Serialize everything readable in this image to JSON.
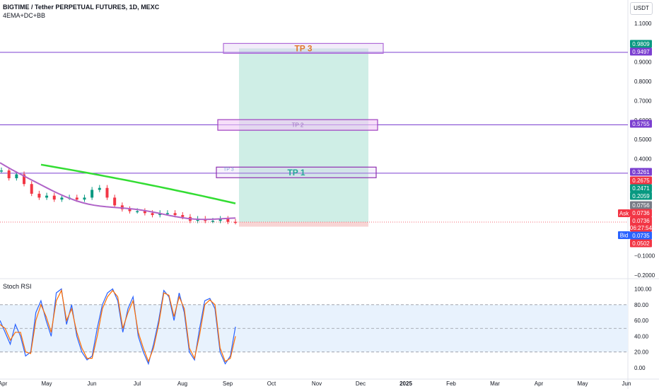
{
  "header": {
    "title": "BIGTIME / Tether PERPETUAL FUTURES, 1D, MEXC",
    "indicator": "4EMA+DC+BB",
    "currency": "USDT"
  },
  "rsi_title": "Stoch RSI",
  "colors": {
    "purple_line": "#7b3fd0",
    "ema_green": "#33dd33",
    "bb_purple": "#b064c8",
    "target_zone": "#cfeee6",
    "stop_zone": "#f8d4d4",
    "tp3_text": "#e07a2e",
    "tp1_text": "#26a69a",
    "rsi_k": "#2962ff",
    "rsi_d": "#ff6d00",
    "rsi_band": "#e8f2fd"
  },
  "chart_data": [
    {
      "type": "candlestick",
      "title": "BIGTIME / Tether PERPETUAL FUTURES, 1D, MEXC",
      "ylim": [
        -0.22,
        1.15
      ],
      "y_ticks": [
        1.1,
        0.9,
        0.8,
        0.7,
        0.6,
        0.5,
        0.4,
        0.1,
        -0.1,
        -0.2
      ],
      "y_tick_labels": [
        "1.1000",
        "0.9000",
        "0.8000",
        "0.7000",
        "0.6000",
        "0.5000",
        "0.4000",
        "0.1000",
        "−0.1000",
        "−0.2000"
      ],
      "x_month_labels": [
        "Apr",
        "May",
        "Jun",
        "Jul",
        "Aug",
        "Sep",
        "Oct",
        "Nov",
        "Dec",
        "2025",
        "Feb",
        "Mar",
        "Apr",
        "May",
        "Jun"
      ],
      "price_points": [
        [
          "Apr",
          0.34
        ],
        [
          "Apr",
          0.3
        ],
        [
          "Apr",
          0.32
        ],
        [
          "Apr",
          0.27
        ],
        [
          "Apr",
          0.22
        ],
        [
          "Apr",
          0.2
        ],
        [
          "May",
          0.21
        ],
        [
          "May",
          0.19
        ],
        [
          "May",
          0.2
        ],
        [
          "May",
          0.2
        ],
        [
          "May",
          0.19
        ],
        [
          "May",
          0.2
        ],
        [
          "Jun",
          0.24
        ],
        [
          "Jun",
          0.25
        ],
        [
          "Jun",
          0.2
        ],
        [
          "Jun",
          0.16
        ],
        [
          "Jun",
          0.14
        ],
        [
          "Jun",
          0.13
        ],
        [
          "Jul",
          0.13
        ],
        [
          "Jul",
          0.12
        ],
        [
          "Jul",
          0.11
        ],
        [
          "Jul",
          0.12
        ],
        [
          "Jul",
          0.12
        ],
        [
          "Jul",
          0.11
        ],
        [
          "Aug",
          0.1
        ],
        [
          "Aug",
          0.08
        ],
        [
          "Aug",
          0.09
        ],
        [
          "Aug",
          0.08
        ],
        [
          "Aug",
          0.08
        ],
        [
          "Aug",
          0.09
        ],
        [
          "Sep",
          0.075
        ],
        [
          "Sep",
          0.074
        ]
      ],
      "horizontal_lines": [
        0.9497,
        0.5755,
        0.3261
      ],
      "targets": [
        {
          "label": "TP 3",
          "price": 0.97
        },
        {
          "label": "TP 2",
          "price": 0.575
        },
        {
          "label": "TP 1",
          "price": 0.33
        },
        {
          "label": "TP 3",
          "price": 0.31
        }
      ],
      "price_tags": [
        {
          "text": "0.9809",
          "value": 0.9809,
          "color": "#089981"
        },
        {
          "text": "0.9497",
          "value": 0.9497,
          "color": "#7b3fd0"
        },
        {
          "text": "0.5755",
          "value": 0.5755,
          "color": "#7b3fd0"
        },
        {
          "text": "0.3261",
          "value": 0.3261,
          "color": "#7b3fd0"
        },
        {
          "text": "0.2675",
          "value": 0.2675,
          "color": "#f23645"
        },
        {
          "text": "0.2471",
          "value": 0.2471,
          "color": "#089981"
        },
        {
          "text": "0.2059",
          "value": 0.2059,
          "color": "#089981"
        },
        {
          "text": "0.0756",
          "value": 0.0756,
          "color": "#787b86"
        },
        {
          "text": "0.0736",
          "value": 0.0736,
          "color": "#f23645"
        },
        {
          "text": "0.0736",
          "value": 0.0736,
          "color": "#f23645"
        },
        {
          "text": "06:27:54",
          "value": 0.0736,
          "color": "#f23645"
        },
        {
          "text": "0.0735",
          "value": 0.0735,
          "color": "#2962ff"
        },
        {
          "text": "0.0502",
          "value": 0.0502,
          "color": "#f23645"
        }
      ],
      "ask_label": "Ask",
      "bid_label": "Bid"
    },
    {
      "type": "line",
      "title": "Stoch RSI",
      "ylim": [
        0,
        100
      ],
      "y_ticks": [
        100,
        80,
        60,
        40,
        20,
        0
      ],
      "y_tick_labels": [
        "100.00",
        "80.00",
        "60.00",
        "40.00",
        "20.00",
        "0.00"
      ],
      "band": [
        20,
        80
      ],
      "series": [
        {
          "values": [
            60,
            45,
            30,
            55,
            40,
            15,
            20,
            70,
            85,
            60,
            40,
            95,
            100,
            55,
            80,
            40,
            20,
            10,
            15,
            50,
            80,
            95,
            100,
            85,
            45,
            75,
            90,
            40,
            20,
            5,
            30,
            60,
            98,
            90,
            60,
            95,
            70,
            20,
            10,
            50,
            85,
            88,
            75,
            20,
            5,
            15,
            52
          ]
        },
        {
          "values": [
            55,
            50,
            35,
            45,
            45,
            20,
            18,
            60,
            80,
            65,
            45,
            85,
            98,
            60,
            75,
            45,
            25,
            12,
            12,
            40,
            75,
            90,
            98,
            90,
            50,
            70,
            85,
            45,
            25,
            8,
            25,
            55,
            95,
            92,
            65,
            90,
            75,
            25,
            12,
            42,
            80,
            86,
            80,
            25,
            8,
            12,
            40
          ]
        }
      ]
    }
  ]
}
